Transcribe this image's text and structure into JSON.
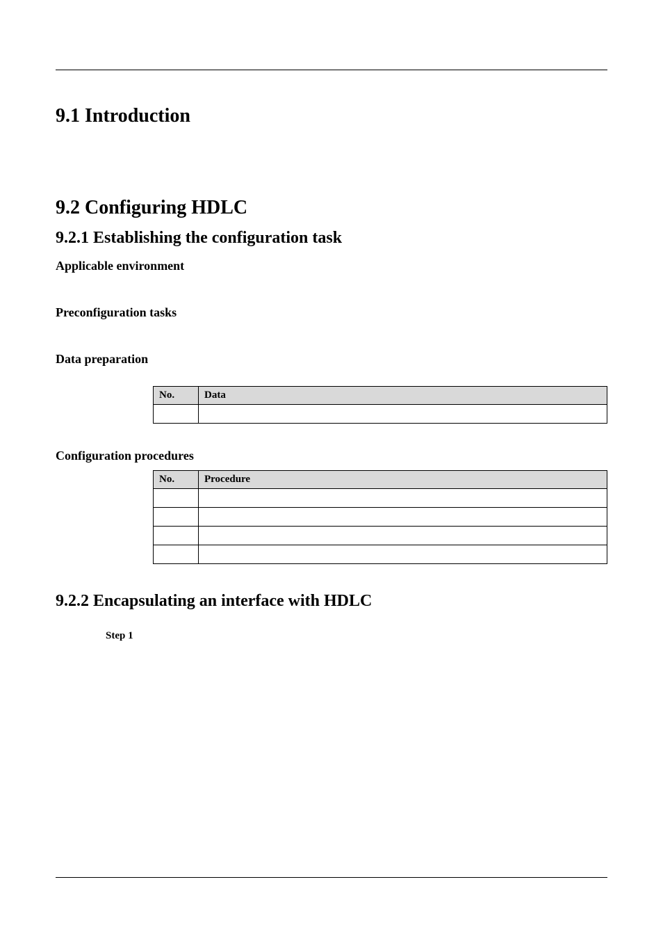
{
  "headings": {
    "h91": "9.1 Introduction",
    "h92": "9.2 Configuring HDLC",
    "h921": "9.2.1 Establishing the configuration task",
    "applicable_env": "Applicable environment",
    "preconfig": "Preconfiguration tasks",
    "dataprep": "Data preparation",
    "config_proc": "Configuration procedures",
    "h922": "9.2.2 Encapsulating an interface with HDLC"
  },
  "table1": {
    "headers": {
      "no": "No.",
      "data": "Data"
    },
    "rows": [
      {
        "no": "",
        "data": ""
      }
    ]
  },
  "table2": {
    "headers": {
      "no": "No.",
      "procedure": "Procedure"
    },
    "rows": [
      {
        "no": "",
        "procedure": ""
      },
      {
        "no": "",
        "procedure": ""
      },
      {
        "no": "",
        "procedure": ""
      },
      {
        "no": "",
        "procedure": ""
      }
    ]
  },
  "step1_label": "Step 1"
}
